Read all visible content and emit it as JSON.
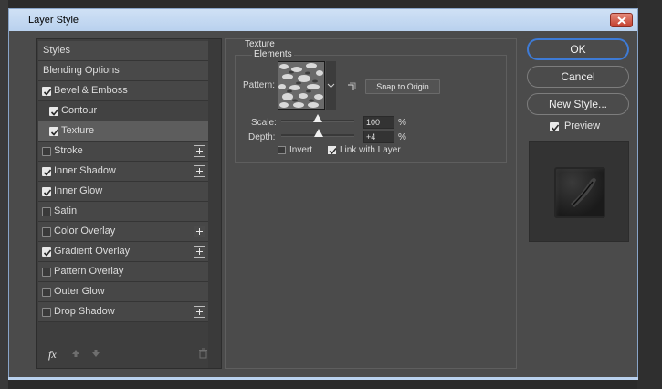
{
  "window": {
    "title": "Layer Style"
  },
  "styles": {
    "items": [
      {
        "label": "Styles",
        "checkbox": false,
        "checked": false,
        "plus": false,
        "indent": false
      },
      {
        "label": "Blending Options",
        "checkbox": false,
        "checked": false,
        "plus": false,
        "indent": false
      },
      {
        "label": "Bevel & Emboss",
        "checkbox": true,
        "checked": true,
        "plus": false,
        "indent": false
      },
      {
        "label": "Contour",
        "checkbox": true,
        "checked": true,
        "plus": false,
        "indent": true
      },
      {
        "label": "Texture",
        "checkbox": true,
        "checked": true,
        "plus": false,
        "indent": true,
        "selected": true
      },
      {
        "label": "Stroke",
        "checkbox": true,
        "checked": false,
        "plus": true,
        "indent": false
      },
      {
        "label": "Inner Shadow",
        "checkbox": true,
        "checked": true,
        "plus": true,
        "indent": false
      },
      {
        "label": "Inner Glow",
        "checkbox": true,
        "checked": true,
        "plus": false,
        "indent": false
      },
      {
        "label": "Satin",
        "checkbox": true,
        "checked": false,
        "plus": false,
        "indent": false
      },
      {
        "label": "Color Overlay",
        "checkbox": true,
        "checked": false,
        "plus": true,
        "indent": false
      },
      {
        "label": "Gradient Overlay",
        "checkbox": true,
        "checked": true,
        "plus": true,
        "indent": false
      },
      {
        "label": "Pattern Overlay",
        "checkbox": true,
        "checked": false,
        "plus": false,
        "indent": false
      },
      {
        "label": "Outer Glow",
        "checkbox": true,
        "checked": false,
        "plus": false,
        "indent": false
      },
      {
        "label": "Drop Shadow",
        "checkbox": true,
        "checked": false,
        "plus": true,
        "indent": false
      }
    ],
    "fx_label": "fx"
  },
  "texture": {
    "group_title": "Texture",
    "elements_title": "Elements",
    "pattern_label": "Pattern:",
    "snap_button": "Snap to Origin",
    "scale_label": "Scale:",
    "scale_value": "100",
    "scale_fraction": 0.5,
    "depth_label": "Depth:",
    "depth_value": "+4",
    "depth_fraction": 0.51,
    "percent": "%",
    "invert_label": "Invert",
    "invert_checked": false,
    "link_label": "Link with Layer",
    "link_checked": true
  },
  "actions": {
    "ok": "OK",
    "cancel": "Cancel",
    "new_style": "New Style...",
    "preview_label": "Preview",
    "preview_checked": true
  },
  "colors": {
    "accent": "#3e7bd6",
    "panel": "#4b4b4b",
    "titlebar": "#b9d1ee"
  }
}
